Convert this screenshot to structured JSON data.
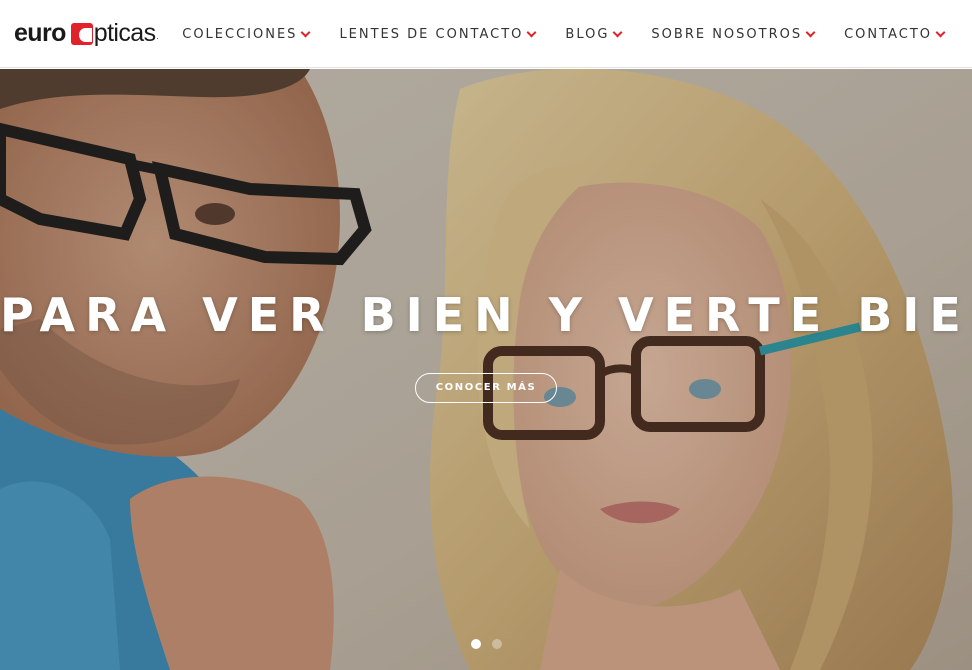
{
  "header": {
    "logo": {
      "part1": "euro",
      "part2": "pticas",
      "dot": ".",
      "brand_color": "#e2222a"
    },
    "nav": [
      {
        "label": "COLECCIONES",
        "icon": "chevron-down-icon"
      },
      {
        "label": "LENTES DE CONTACTO",
        "icon": "chevron-down-icon"
      },
      {
        "label": "BLOG",
        "icon": "chevron-down-icon"
      },
      {
        "label": "SOBRE NOSOTROS",
        "icon": "chevron-down-icon"
      },
      {
        "label": "CONTACTO",
        "icon": "chevron-down-icon"
      }
    ]
  },
  "hero": {
    "title": "PARA VER BIEN Y VERTE BIEN",
    "button_label": "CONOCER MÁS",
    "slides_total": 2,
    "active_slide": 1
  },
  "colors": {
    "accent": "#e2222a",
    "nav_text": "#333333"
  }
}
